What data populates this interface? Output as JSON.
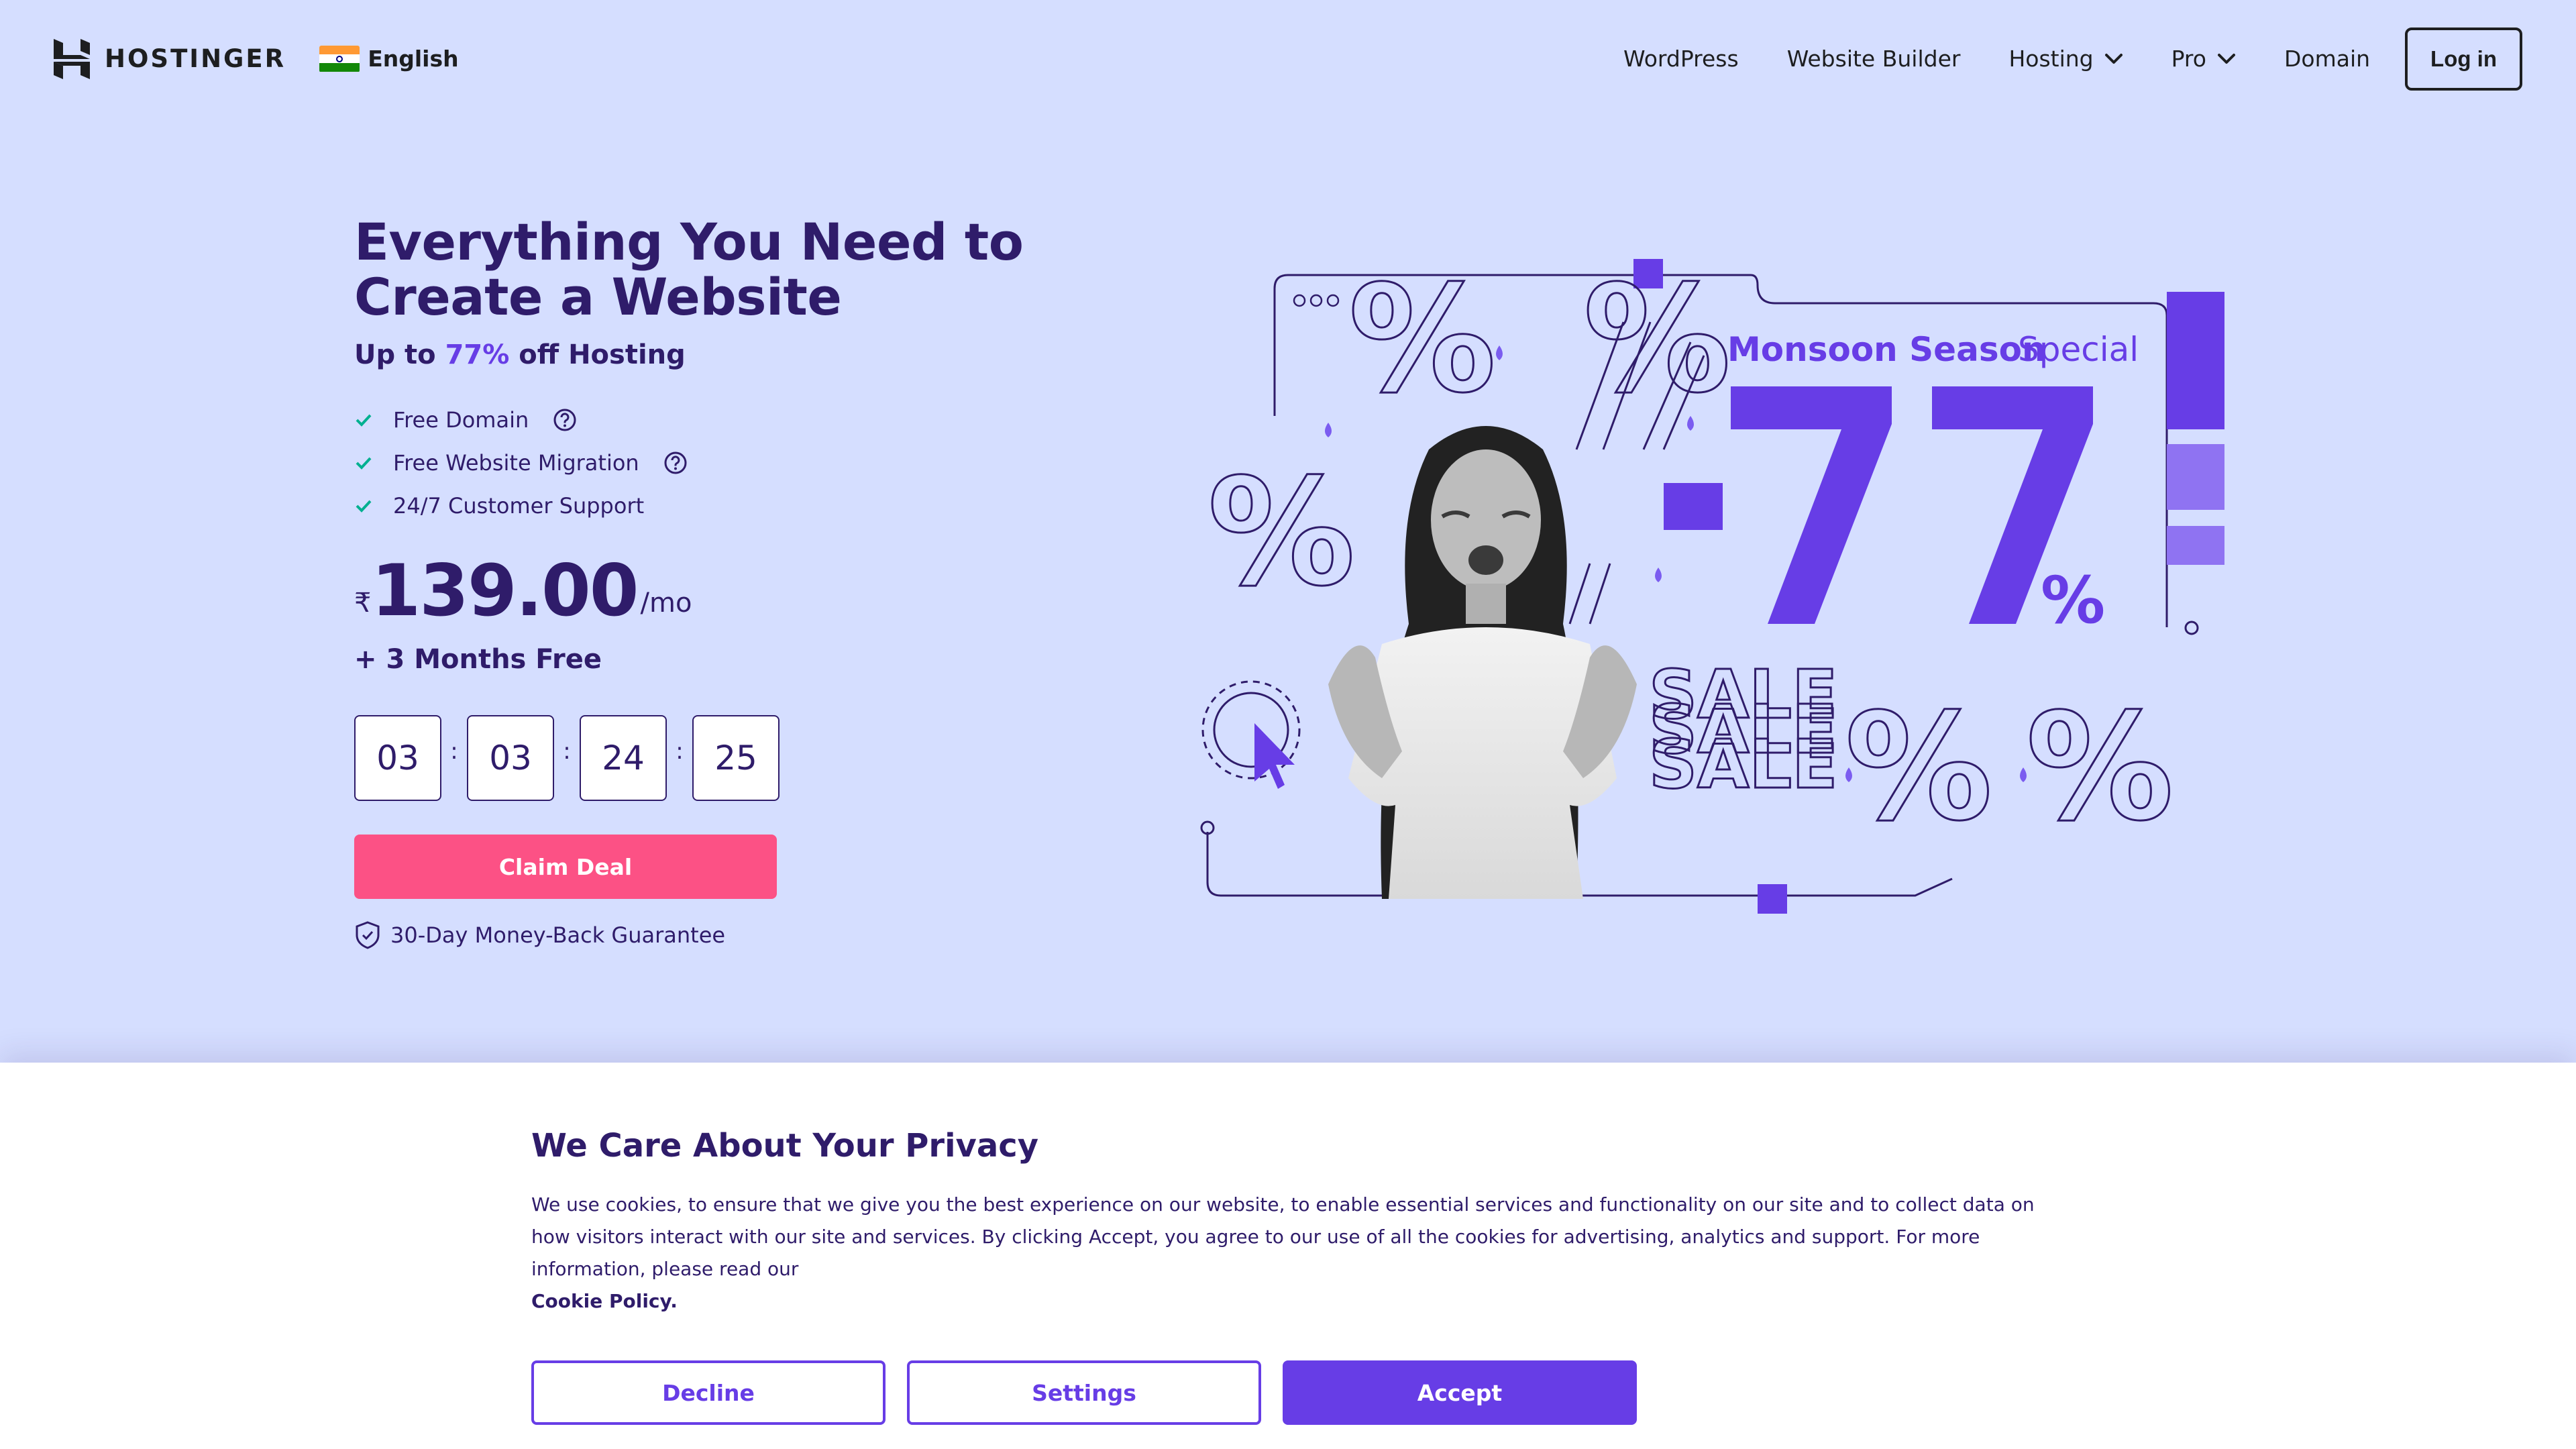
{
  "header": {
    "logo_text": "HOSTINGER",
    "language": "English",
    "nav": [
      {
        "label": "WordPress",
        "has_dropdown": false
      },
      {
        "label": "Website Builder",
        "has_dropdown": false
      },
      {
        "label": "Hosting",
        "has_dropdown": true
      },
      {
        "label": "Pro",
        "has_dropdown": true
      },
      {
        "label": "Domain",
        "has_dropdown": false
      }
    ],
    "login_label": "Log in"
  },
  "hero": {
    "title": "Everything You Need to Create a Website",
    "subtitle_prefix": "Up to ",
    "subtitle_discount": "77%",
    "subtitle_suffix": " off Hosting",
    "features": [
      {
        "label": "Free Domain",
        "has_help": true
      },
      {
        "label": "Free Website Migration",
        "has_help": true
      },
      {
        "label": "24/7 Customer Support",
        "has_help": false
      }
    ],
    "currency": "₹",
    "price": "139.00",
    "period": "/mo",
    "bonus": "+ 3 Months Free",
    "timer": [
      "03",
      "03",
      "24",
      "25"
    ],
    "timer_separator": ":",
    "claim_label": "Claim Deal",
    "guarantee": "30-Day Money-Back Guarantee"
  },
  "promo": {
    "headline_bold": "Monsoon Season",
    "headline_light": "Special",
    "discount": "-77",
    "percent": "%",
    "sale_word": "SALE"
  },
  "cookie": {
    "title": "We Care About Your Privacy",
    "text": "We use cookies, to ensure that we give you the best experience on our website, to enable essential services and functionality on our site and to collect data on how visitors interact with our site and services. By clicking Accept, you agree to our use of all the cookies for advertising, analytics and support. For more information, please read our ",
    "link": "Cookie Policy.",
    "decline_label": "Decline",
    "settings_label": "Settings",
    "accept_label": "Accept"
  },
  "colors": {
    "background": "#d5deff",
    "navy": "#2f1c6a",
    "purple": "#673de6",
    "pink": "#fc5185",
    "check_green": "#00b090"
  },
  "icons": [
    "logo-icon",
    "india-flag-icon",
    "chevron-down-icon",
    "check-icon",
    "help-icon",
    "shield-icon",
    "cursor-icon"
  ]
}
